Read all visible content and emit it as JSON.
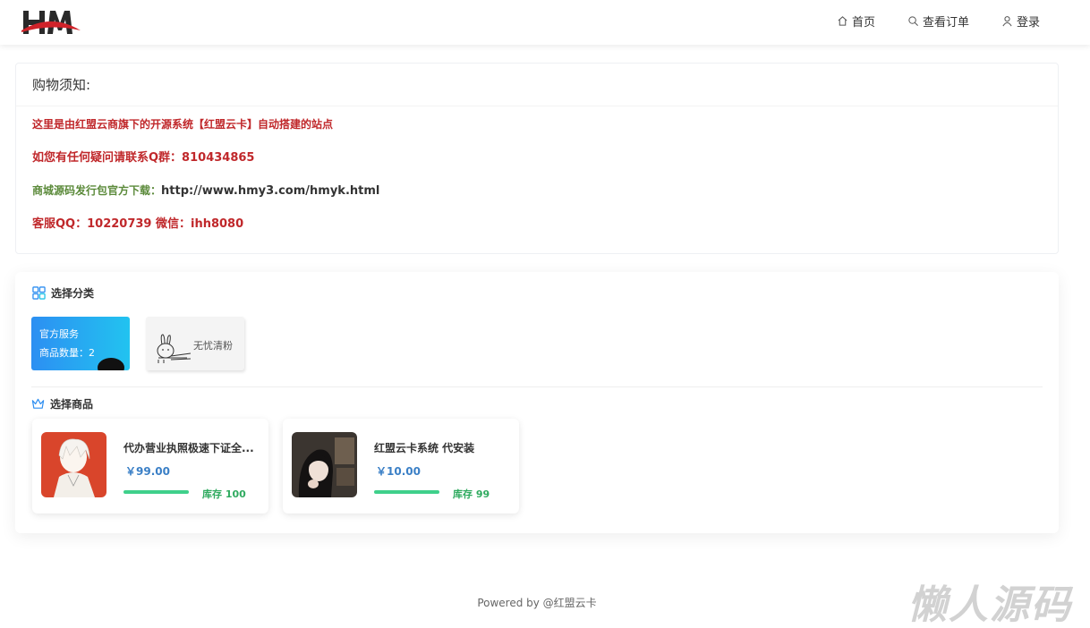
{
  "header": {
    "nav": [
      {
        "label": "首页",
        "icon": "home-icon"
      },
      {
        "label": "查看订单",
        "icon": "search-icon"
      },
      {
        "label": "登录",
        "icon": "user-icon"
      }
    ]
  },
  "notice": {
    "title": "购物须知:",
    "line1": "这里是由红盟云商旗下的开源系统【红盟云卡】自动搭建的站点",
    "line2": "如您有任何疑问请联系Q群：810434865",
    "line3_prefix": "商城源码发行包官方下载：",
    "line3_link": "http://www.hmy3.com/hmyk.html",
    "line4": "客服QQ：10220739  微信：ihh8080"
  },
  "shop": {
    "category_title": "选择分类",
    "categories": [
      {
        "name": "官方服务",
        "count_label": "商品数量：2"
      },
      {
        "name": "无忧清粉"
      }
    ],
    "product_title": "选择商品",
    "products": [
      {
        "name": "代办营业执照极速下证全...",
        "price": "￥99.00",
        "stock": "库存 100"
      },
      {
        "name": "红盟云卡系统 代安装",
        "price": "￥10.00",
        "stock": "库存 99"
      }
    ]
  },
  "footer": {
    "text": "Powered by @红盟云卡"
  },
  "watermark": "懒人源码",
  "colors": {
    "notice_red": "#c0282b",
    "notice_green": "#5b8a3a",
    "price_blue": "#3a7fc6",
    "stock_green": "#2faa5f",
    "category_gradient_start": "#2c8ff2",
    "category_gradient_end": "#22c3f0"
  }
}
